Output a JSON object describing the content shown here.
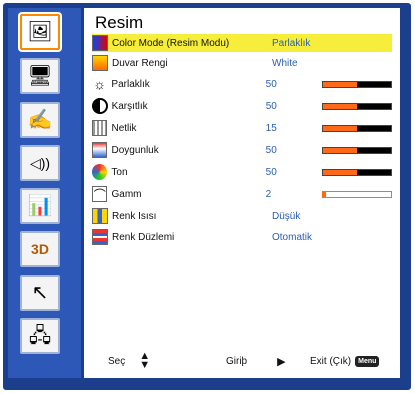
{
  "panel": {
    "title": "Resim",
    "rows": [
      {
        "label": "Color Mode (Resim Modu)",
        "value": "Parlaklık",
        "icon": "color-mode-icon"
      },
      {
        "label": "Duvar Rengi",
        "value": "White",
        "icon": "wall-color-icon"
      },
      {
        "label": "Parlaklık",
        "value": "50",
        "level": 0.5,
        "icon": "sun-icon"
      },
      {
        "label": "Karşıtlık",
        "value": "50",
        "level": 0.5,
        "icon": "contrast-icon"
      },
      {
        "label": "Netlik",
        "value": "15",
        "level": 0.5,
        "icon": "sharpness-icon"
      },
      {
        "label": "Doygunluk",
        "value": "50",
        "level": 0.5,
        "icon": "saturation-icon"
      },
      {
        "label": "Ton",
        "value": "50",
        "level": 0.5,
        "icon": "tint-icon"
      },
      {
        "label": "Gamm",
        "value": "2",
        "level": 0.05,
        "icon": "gamma-icon"
      },
      {
        "label": "Renk Isısı",
        "value": "Düşük",
        "icon": "color-temp-icon"
      },
      {
        "label": "Renk Düzlemi",
        "value": "Otomatik",
        "icon": "color-space-icon"
      }
    ]
  },
  "footer": {
    "select_label": "Seç",
    "enter_label": "Giriþ",
    "exit_label": "Exit (Çık)",
    "menu_badge": "Menu"
  },
  "sidebar": {
    "items": [
      {
        "icon": "picture-icon"
      },
      {
        "icon": "screen-icon"
      },
      {
        "icon": "settings-hand-icon"
      },
      {
        "icon": "volume-icon"
      },
      {
        "icon": "options-icon"
      },
      {
        "icon": "3d-icon",
        "text": "3D"
      },
      {
        "icon": "interactive-icon"
      },
      {
        "icon": "lan-icon"
      }
    ]
  }
}
